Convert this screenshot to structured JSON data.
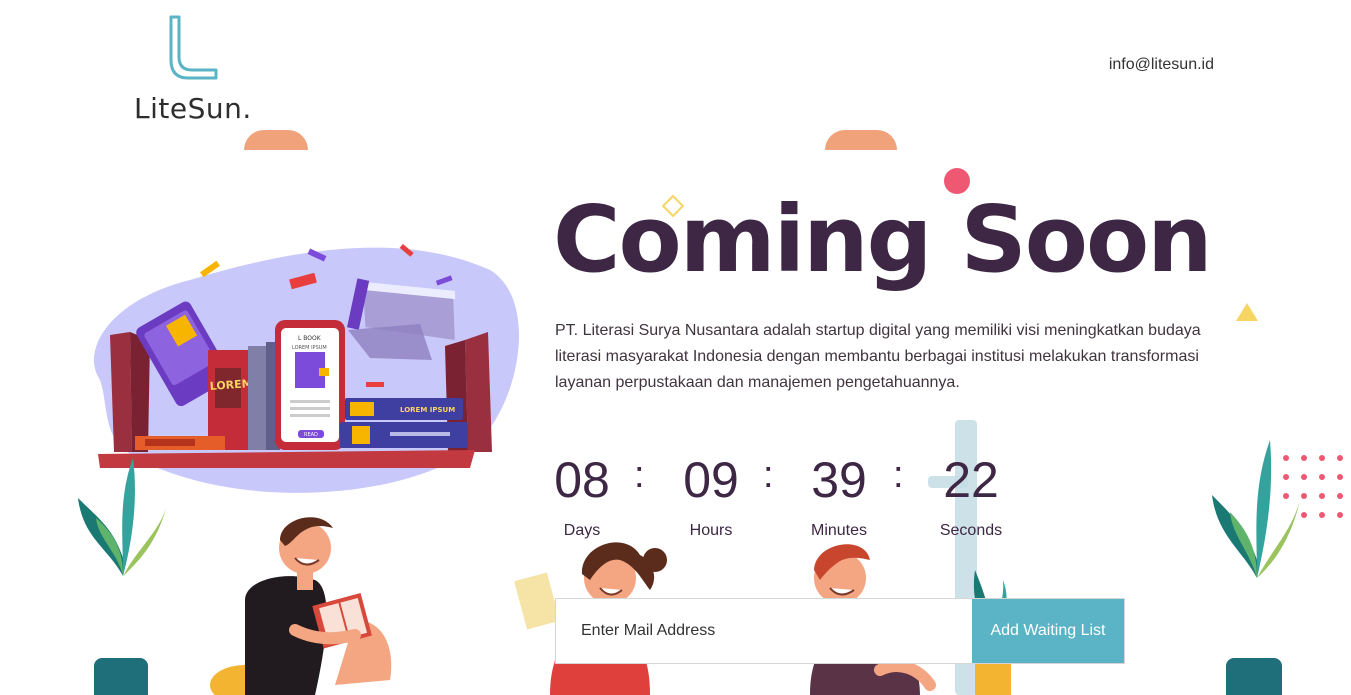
{
  "header": {
    "logo_text": "LiteSun.",
    "email": "info@litesun.id"
  },
  "hero": {
    "title": "Coming Soon",
    "description": "PT. Literasi Surya Nusantara adalah startup digital yang memiliki visi meningkatkan budaya literasi masyarakat Indonesia dengan membantu berbagai institusi melakukan transformasi layanan perpustakaan dan manajemen pengetahuannya."
  },
  "countdown": {
    "days": {
      "value": "08",
      "label": "Days"
    },
    "hours": {
      "value": "09",
      "label": "Hours"
    },
    "minutes": {
      "value": "39",
      "label": "Minutes"
    },
    "seconds": {
      "value": "22",
      "label": "Seconds"
    },
    "separator": ":"
  },
  "form": {
    "placeholder": "Enter Mail Address",
    "value": "",
    "button_label": "Add Waiting List"
  },
  "illustration": {
    "book_text_1": "LOREM IPSUM",
    "book_text_2": "LOREM IPSUM",
    "phone_title": "L BOOK",
    "phone_subtitle": "LOREM IPSUM",
    "phone_button": "READ"
  },
  "colors": {
    "accent_teal": "#5ab4c5",
    "title": "#3d2744",
    "blob": "#c9c8fb",
    "peach": "#f0a27a",
    "pink": "#ef5873",
    "yellow": "#f7d562"
  }
}
